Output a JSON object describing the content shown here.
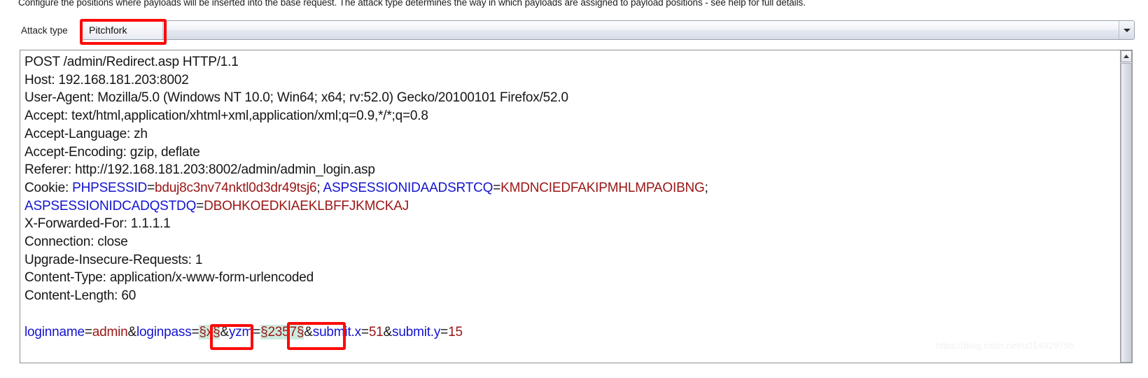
{
  "description": "Configure the positions where payloads will be inserted into the base request. The attack type determines the way in which payloads are assigned to payload positions - see help for full details.",
  "attack_type": {
    "label": "Attack type",
    "selected": "Pitchfork",
    "dropdown_icon": "chevron-down-icon"
  },
  "request": {
    "request_line": "POST /admin/Redirect.asp HTTP/1.1",
    "headers": [
      "Host: 192.168.181.203:8002",
      "User-Agent: Mozilla/5.0 (Windows NT 10.0; Win64; x64; rv:52.0) Gecko/20100101 Firefox/52.0",
      "Accept: text/html,application/xhtml+xml,application/xml;q=0.9,*/*;q=0.8",
      "Accept-Language: zh",
      "Accept-Encoding: gzip, deflate",
      "Referer: http://192.168.181.203:8002/admin/admin_login.asp"
    ],
    "cookie_label": "Cookie: ",
    "cookies": [
      {
        "name": "PHPSESSID",
        "value": "bduj8c3nv74nktl0d3dr49tsj6",
        "sep": "; "
      },
      {
        "name": "ASPSESSIONIDAADSRTCQ",
        "value": "KMDNCIEDFAKIPMHLMPAOIBNG",
        "sep": "; "
      },
      {
        "name": "ASPSESSIONIDCADQSTDQ",
        "value": "DBOHKOEDKIAEKLBFFJKMCKAJ",
        "sep": ""
      }
    ],
    "headers_after_cookie": [
      "X-Forwarded-For: 1.1.1.1",
      "Connection: close",
      "Upgrade-Insecure-Requests: 1",
      "Content-Type: application/x-www-form-urlencoded",
      "Content-Length: 60"
    ],
    "body_tokens": [
      {
        "t": "loginname",
        "k": "key"
      },
      {
        "t": "=",
        "k": "eq"
      },
      {
        "t": "admin",
        "k": "val"
      },
      {
        "t": "&",
        "k": "amp"
      },
      {
        "t": "loginpass",
        "k": "key"
      },
      {
        "t": "=",
        "k": "eq"
      },
      {
        "t": "§x§",
        "k": "marker"
      },
      {
        "t": "&",
        "k": "amp"
      },
      {
        "t": "yzm",
        "k": "key"
      },
      {
        "t": "=",
        "k": "eq"
      },
      {
        "t": "§2357§",
        "k": "marker"
      },
      {
        "t": "&",
        "k": "amp"
      },
      {
        "t": "submit.x",
        "k": "key"
      },
      {
        "t": "=",
        "k": "eq"
      },
      {
        "t": "51",
        "k": "val"
      },
      {
        "t": "&",
        "k": "amp"
      },
      {
        "t": "submit.y",
        "k": "key"
      },
      {
        "t": "=",
        "k": "eq"
      },
      {
        "t": "15",
        "k": "val"
      }
    ]
  },
  "scrollbar": {
    "up_arrow_icon": "triangle-up-icon"
  },
  "annotations": {
    "box_count": 3,
    "color": "#fb0b09"
  },
  "watermark": "https://blog.csdn.net/u014029795",
  "colors": {
    "cookie_name": "#1414cf",
    "cookie_value": "#9a1616",
    "payload_marker_bg": "#ccebdf",
    "annotation_red": "#fb0b09"
  }
}
